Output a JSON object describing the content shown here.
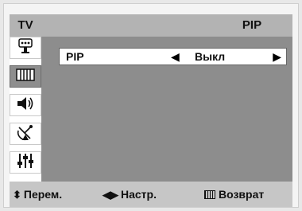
{
  "header": {
    "source": "TV",
    "title": "PIP"
  },
  "sidebar": {
    "items": [
      {
        "name": "input",
        "icon": "input-icon",
        "active": false
      },
      {
        "name": "picture",
        "icon": "picture-icon",
        "active": true
      },
      {
        "name": "sound",
        "icon": "speaker-icon",
        "active": false
      },
      {
        "name": "channel",
        "icon": "antenna-icon",
        "active": false
      },
      {
        "name": "setup",
        "icon": "settings-sliders-icon",
        "active": false
      }
    ]
  },
  "menu_item": {
    "label": "PIP",
    "value": "Выкл",
    "left_arrow": "◀",
    "right_arrow": "▶"
  },
  "footer": {
    "move_glyph": "⬍",
    "move_label": "Перем.",
    "adjust_glyph": "◀▶",
    "adjust_label": "Настр.",
    "return_label": "Возврат"
  },
  "colors": {
    "title_bar": "#b3b3b3",
    "content_bg": "#8d8d8d",
    "footer_bg": "#c6c6c6",
    "active_item": "#8e8e8e"
  }
}
